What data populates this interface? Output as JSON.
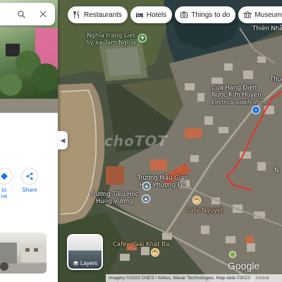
{
  "chips": [
    {
      "label": "Restaurants",
      "icon": "restaurant-icon"
    },
    {
      "label": "Hotels",
      "icon": "hotel-icon"
    },
    {
      "label": "Things to do",
      "icon": "camera-icon"
    },
    {
      "label": "Museums",
      "icon": "museum-icon"
    }
  ],
  "panel": {
    "actions": [
      {
        "label": "to",
        "sublabel": "ne",
        "icon": "directions-icon"
      },
      {
        "label": "Share",
        "icon": "share-icon"
      }
    ]
  },
  "map": {
    "watermark": "choTOT",
    "places": {
      "cemetery": {
        "line1": "Nghĩa trang Liệt",
        "line2": "Sỹ xã Tam Nghĩa"
      },
      "thien_nhan": "Thiên Nhẫn",
      "thuc": "Thục",
      "store": {
        "line1": "Cửa Hàng Điện",
        "line2": "Nước Kim Huyền",
        "line3": "Electrical supply store"
      },
      "kindergarten": {
        "line1": "Trường Mẫu Giáo",
        "line2": "Hoa Phượng Đỏ"
      },
      "primary_school": {
        "line1": "Trường Tiểu Học",
        "line2": "Hùng Vương"
      },
      "cafe_nguyet": "Cafe Nguyệt",
      "cafe_giai_khat": "Cafe - Giải Khát Ba",
      "edge_label": "N"
    }
  },
  "layers": {
    "label": "Layers"
  },
  "google_logo": "Google",
  "attribution": "Imagery ©2023 CNES / Airbus, Maxar Technologies, Map data ©2023",
  "attribution_extra": "Global",
  "colors": {
    "route": "#e8312b",
    "link_blue": "#1a73e8"
  }
}
